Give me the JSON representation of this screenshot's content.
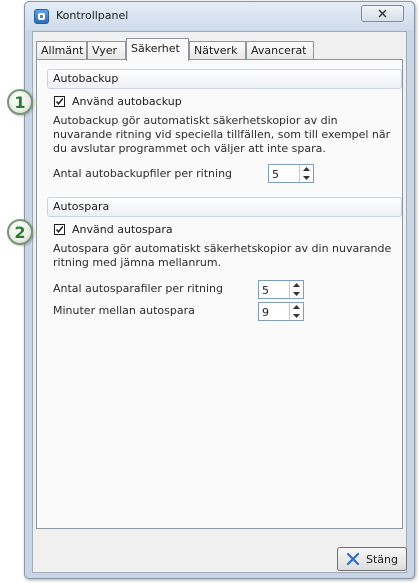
{
  "window": {
    "title": "Kontrollpanel",
    "close_icon": "close-icon"
  },
  "tabs": [
    {
      "label": "Allmänt",
      "active": false
    },
    {
      "label": "Vyer",
      "active": false
    },
    {
      "label": "Säkerhet",
      "active": true
    },
    {
      "label": "Nätverk",
      "active": false
    },
    {
      "label": "Avancerat",
      "active": false
    }
  ],
  "autobackup": {
    "header": "Autobackup",
    "checkbox_label": "Använd autobackup",
    "checked": true,
    "description": "Autobackup gör automatiskt säkerhetskopior av din nuvarande ritning vid speciella tillfällen, som till exempel när du avslutar programmet och väljer att inte spara.",
    "files_label": "Antal autobackupfiler per ritning",
    "files_value": "5"
  },
  "autosave": {
    "header": "Autospara",
    "checkbox_label": "Använd autospara",
    "checked": true,
    "description": "Autospara gör automatiskt säkerhetskopior av din nuvarande ritning med jämna mellanrum.",
    "files_label": "Antal autosparafiler per ritning",
    "files_value": "5",
    "minutes_label": "Minuter mellan autospara",
    "minutes_value": "9"
  },
  "callouts": [
    "1",
    "2"
  ],
  "footer": {
    "close_label": "Stäng",
    "close_icon": "x-icon"
  },
  "colors": {
    "window_frame": "#c9d6e6",
    "callout_number": "#2d7a2f",
    "close_x": "#2a6fc9"
  }
}
